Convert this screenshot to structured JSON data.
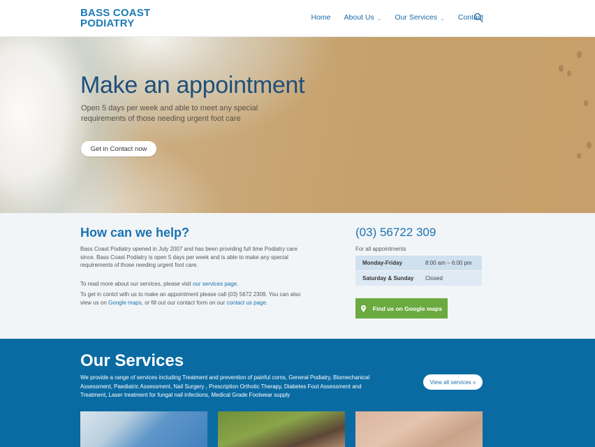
{
  "header": {
    "logo_line1": "BASS COAST",
    "logo_line2": "PODIATRY",
    "nav": {
      "home": "Home",
      "about": "About Us",
      "services": "Our Services",
      "contact": "Contact"
    },
    "search_icon": "search-icon"
  },
  "hero": {
    "title": "Make an appointment",
    "subtitle": "Open 5 days per week and able to meet any special requirements of those needing urgent foot care",
    "button": "Get in Contact now"
  },
  "help": {
    "title": "How can we help?",
    "para1": "Bass Coast Podiatry opened in July 2007 and has been providing full time Podiatry care since. Bass Coast Podiatry is open 5 days per week and is able to make any special requirements of those needing urgent foot care.",
    "para2_prefix": "To read more about our services, please visit ",
    "para2_link": "our services page",
    "para2_suffix": ".",
    "para3_prefix": "To get in contct with us to make an appointment please call (03) 5672 2309. You can also view us on ",
    "para3_link1": "Google maps",
    "para3_mid": ", or fill out our contact form on our ",
    "para3_link2": "contact us page",
    "para3_suffix": "."
  },
  "contact": {
    "phone": "(03) 56722 309",
    "appointments_label": "For all appointments",
    "hours": [
      {
        "day": "Monday-Friday",
        "time": "8:00 am – 6:00 pm"
      },
      {
        "day": "Saturday & Sunday",
        "time": "Closed"
      }
    ],
    "maps_button": "Find us on Google maps",
    "maps_icon": "map-pin-icon"
  },
  "services": {
    "title": "Our Services",
    "description": "We provide a range of services including Treatment and prevention of painful corns, General Podiatry, Biomechanical Assessment, Paediatric Assessment, Nail Surgery , Prescription Orthotic Therapy, Diabetes Foot Assessment and Treatment, Laser treatment for fungal nail infections, Medical Grade Footwear supply",
    "view_all": "View all services  »"
  },
  "colors": {
    "brand_blue": "#1a72b0",
    "services_bg": "#0a6ba3",
    "maps_green": "#6aaa3f"
  }
}
